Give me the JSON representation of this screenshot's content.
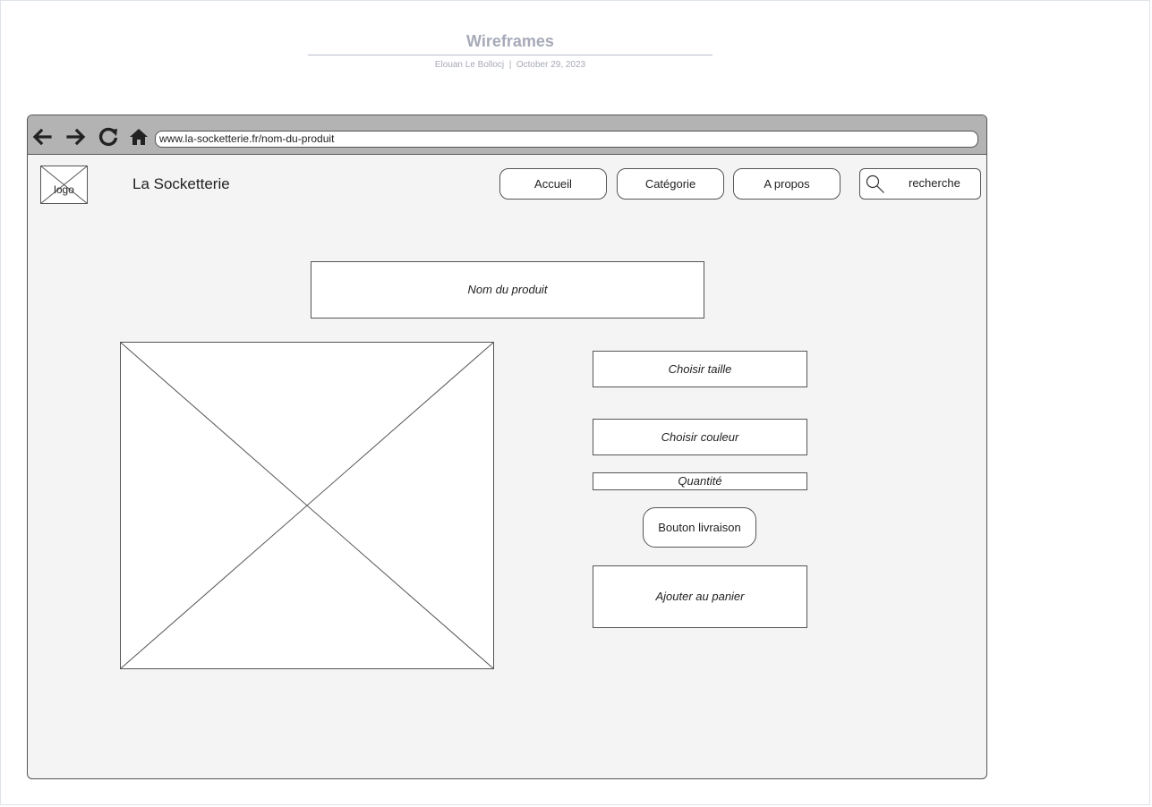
{
  "document": {
    "title": "Wireframes",
    "meta": "Elouan Le Bollocj  |  October 29, 2023"
  },
  "browser": {
    "nav_icons": [
      "back-arrow-icon",
      "forward-arrow-icon",
      "reload-icon",
      "home-icon"
    ],
    "url": "www.la-socketterie.fr/nom-du-produit"
  },
  "header": {
    "logo_label": "logo",
    "site_name": "La Socketterie",
    "nav": [
      {
        "label": "Accueil"
      },
      {
        "label": "Catégorie"
      },
      {
        "label": "A propos"
      }
    ],
    "search": {
      "label": "recherche",
      "icon": "search-icon"
    }
  },
  "product": {
    "name": "Nom du produit",
    "choose_size": "Choisir taille",
    "choose_color": "Choisir couleur",
    "quantity": "Quantité",
    "delivery_button": "Bouton livraison",
    "add_to_cart": "Ajouter au panier"
  },
  "colors": {
    "stroke": "#555555",
    "chrome": "#b3b3b3",
    "canvas": "#f4f4f4",
    "title": "#a7aab8"
  }
}
